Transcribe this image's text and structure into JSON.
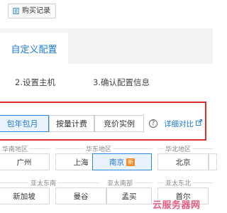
{
  "toolbar": {
    "purchase_records_label": "购买记录"
  },
  "tabs": {
    "active_label": "自定义配置"
  },
  "steps": [
    {
      "label": "2.设置主机"
    },
    {
      "label": "3.确认配置信息"
    }
  ],
  "billing": {
    "options": [
      {
        "label": "包年包月",
        "selected": true
      },
      {
        "label": "按量计费",
        "selected": false
      },
      {
        "label": "竞价实例",
        "selected": false
      }
    ],
    "help_icon": "?",
    "compare_label": "详细对比"
  },
  "regions": [
    {
      "name": "华南地区",
      "cities": [
        {
          "label": "广州"
        }
      ]
    },
    {
      "name": "华东地区",
      "cities": [
        {
          "label": "上海"
        },
        {
          "label": "南京",
          "badge": "新",
          "selected": true
        }
      ]
    },
    {
      "name": "华北地区",
      "cities": [
        {
          "label": "北京"
        }
      ]
    },
    {
      "name": "亚太东南",
      "cities": [
        {
          "label": "新加坡"
        },
        {
          "label": "曼谷"
        }
      ]
    },
    {
      "name": "亚太南部",
      "cities": [
        {
          "label": "孟买"
        }
      ]
    },
    {
      "name": "亚太东北",
      "cities": [
        {
          "label": "首尔"
        }
      ]
    }
  ],
  "watermark": "云服务器网",
  "colors": {
    "accent": "#1c78d8",
    "highlight_border": "#e02f2f",
    "badge": "#f08a24"
  }
}
